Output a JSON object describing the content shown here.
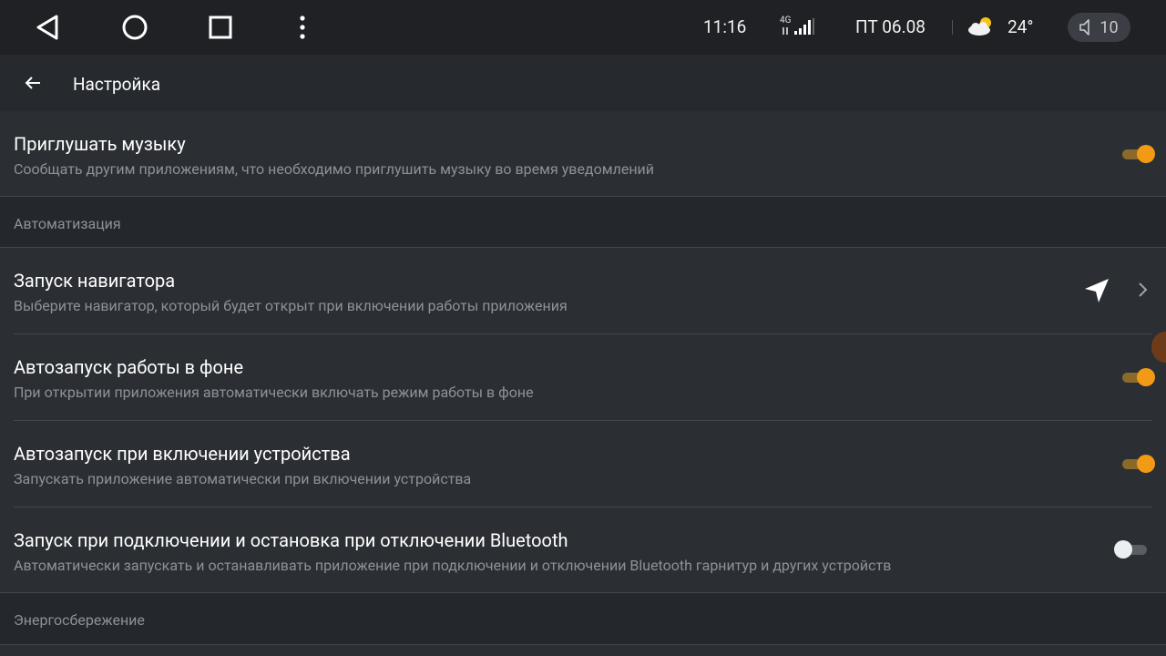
{
  "status_bar": {
    "time": "11:16",
    "network": "4G",
    "date": "ПТ 06.08",
    "temperature": "24°",
    "volume": "10",
    "icons": {
      "back": "back-triangle-icon",
      "home": "home-circle-icon",
      "recents": "recents-square-icon",
      "menu": "overflow-menu-icon",
      "signal": "signal-icon",
      "weather": "partly-cloudy-icon",
      "volume": "speaker-muted-icon"
    }
  },
  "toolbar": {
    "title": "Настройка"
  },
  "settings": {
    "mute_music": {
      "title": "Приглушать музыку",
      "subtitle": "Сообщать другим приложениям, что необходимо приглушить музыку во время уведомлений",
      "enabled": true
    },
    "section_automation": "Автоматизация",
    "navigator": {
      "title": "Запуск навигатора",
      "subtitle": "Выберите навигатор, который будет открыт при включении работы приложения"
    },
    "autostart_background": {
      "title": "Автозапуск работы в фоне",
      "subtitle": "При открытии приложения автоматически включать режим работы в фоне",
      "enabled": true
    },
    "autostart_boot": {
      "title": "Автозапуск при включении устройства",
      "subtitle": "Запускать приложение автоматически при включении устройства",
      "enabled": true
    },
    "bluetooth": {
      "title": "Запуск при подключении и остановка при отключении Bluetooth",
      "subtitle": "Автоматически запускать и останавливать приложение при подключении и отключении Bluetooth гарнитур и других устройств",
      "enabled": false
    },
    "section_power": "Энергосбережение"
  },
  "colors": {
    "accent": "#f29a16",
    "background": "#2b2e33",
    "section_bg": "#24272b",
    "statusbar_bg": "#1f2125"
  }
}
